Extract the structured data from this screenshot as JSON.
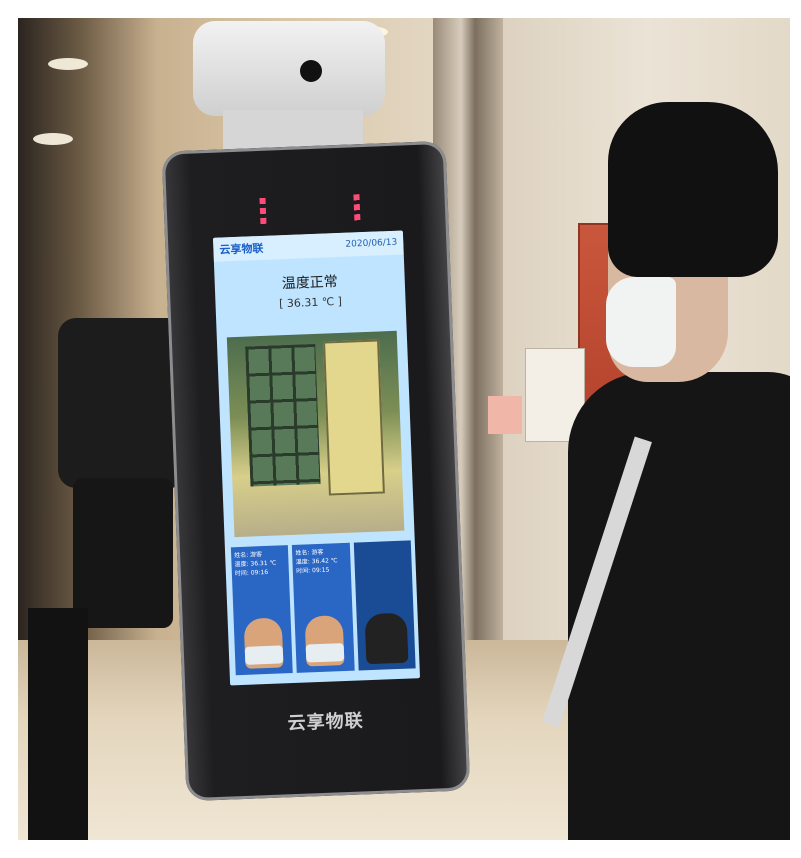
{
  "scene": "photo",
  "device": {
    "screen_header_logo": "云享物联",
    "screen_header_time": "2020/06/13",
    "status_text": "温度正常",
    "temperature_text": "[ 36.31 ℃ ]",
    "cards": [
      {
        "label": "姓名: 游客",
        "temp": "温度: 36.31 ℃",
        "time": "时间: 09:16"
      },
      {
        "label": "姓名: 游客",
        "temp": "温度: 36.42 ℃",
        "time": "时间: 09:15"
      },
      {
        "label": "",
        "temp": "",
        "time": ""
      }
    ],
    "brand_text": "云享物联"
  },
  "colors": {
    "screen_bg": "#bfe4ff",
    "card_bg": "#2a66c4",
    "poster_red": "#c9573c"
  }
}
